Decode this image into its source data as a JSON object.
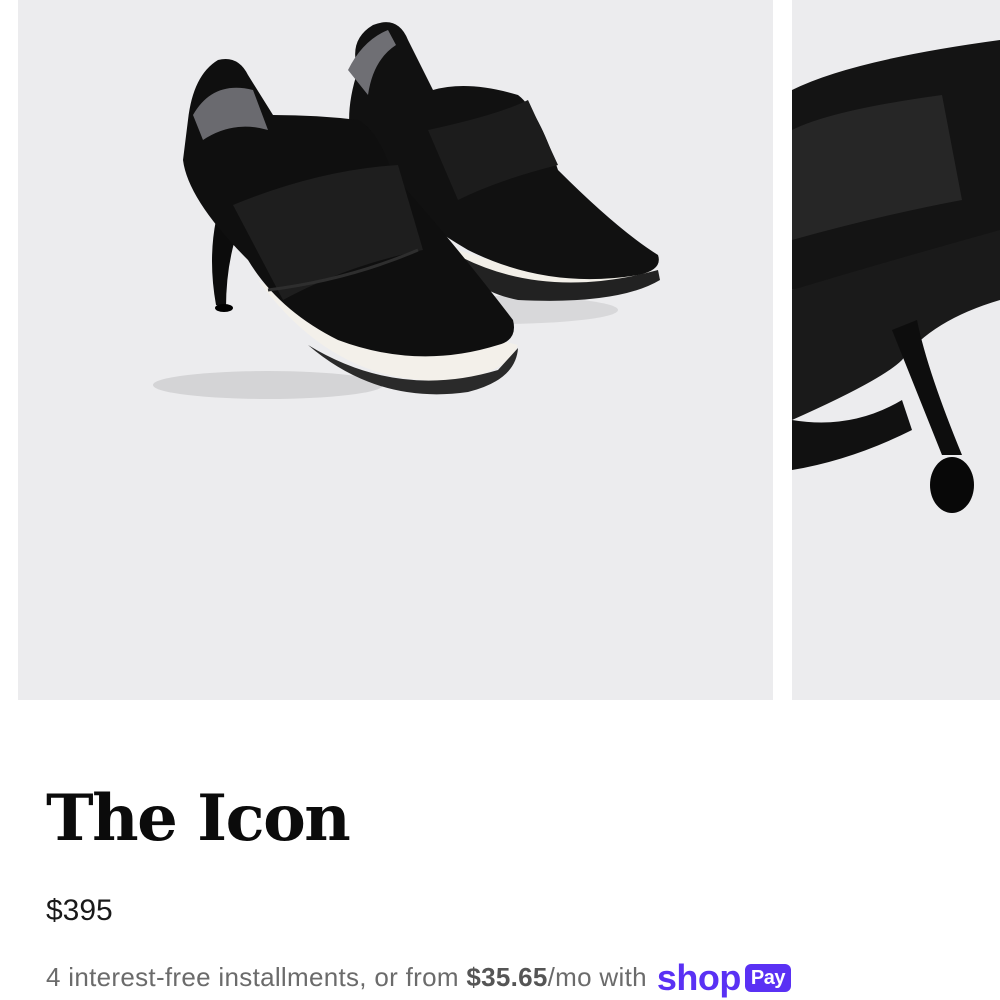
{
  "product": {
    "title": "The Icon",
    "price": "$395"
  },
  "installments": {
    "prefix": "4 interest-free installments, or from ",
    "amount": "$35.65",
    "suffix": "/mo with",
    "provider_logo_text": "shop",
    "provider_badge": "Pay"
  },
  "gallery": {
    "images": [
      "shoe-pair-icon",
      "shoe-heel-closeup-icon"
    ],
    "background": "#ececee"
  },
  "colors": {
    "shop_pay_purple": "#5a31f4",
    "text_dark": "#0b0b0b",
    "text_muted": "#6b6b6b"
  }
}
